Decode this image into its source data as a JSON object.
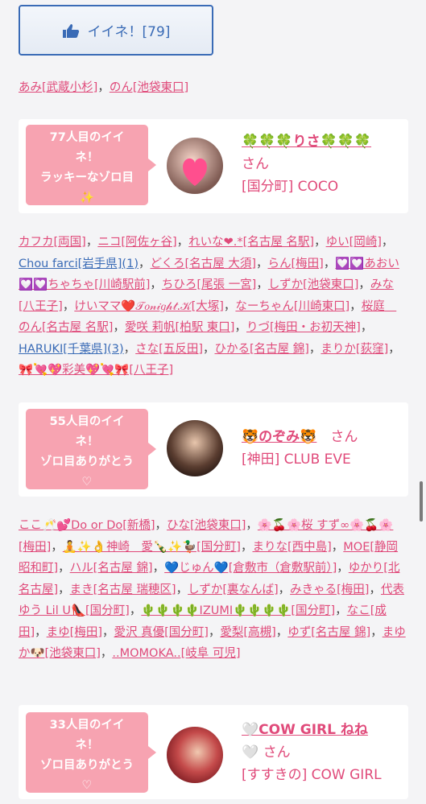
{
  "like_button": {
    "label": "イイネ！[79]"
  },
  "top_names": [
    {
      "text": "あみ[武蔵小杉]",
      "sep": "，"
    },
    {
      "text": "のん[池袋東口]",
      "sep": ""
    }
  ],
  "cards": [
    {
      "bubble": [
        "77人目のイイ",
        "ネ！",
        "ラッキーなゾロ目",
        "✨"
      ],
      "name": "🍀🍀🍀りさ🍀🍀🍀",
      "san": "さん",
      "shop": "[国分町] COCO"
    },
    {
      "bubble": [
        "55人目のイイ",
        "ネ！",
        "ゾロ目ありがとう",
        "♡"
      ],
      "name": "🐯のぞみ🐯",
      "san": "さん",
      "shop": "[神田] CLUB EVE"
    },
    {
      "bubble": [
        "33人目のイイ",
        "ネ！",
        "ゾロ目ありがとう",
        "♡"
      ],
      "name": "🤍COW GIRL ねね",
      "san": "🤍 さん",
      "shop": "[すすきの] COW GIRL"
    }
  ],
  "names_block_1": [
    {
      "text": "カフカ[両国]",
      "sep": "，"
    },
    {
      "text": "ニコ[阿佐ヶ谷]",
      "sep": "，"
    },
    {
      "text": "れいな❤︎.*[名古屋 名駅]",
      "sep": "，"
    },
    {
      "text": "ゆい[岡崎]",
      "sep": "，"
    },
    {
      "text": "Chou farci[岩手県](1)",
      "sep": "，",
      "blue": true
    },
    {
      "text": "どくろ[名古屋 大須]",
      "sep": "，"
    },
    {
      "text": "らん[梅田]",
      "sep": "，"
    },
    {
      "text": "💟💟あおい💟💟ちゃちゃ[川崎駅前]",
      "sep": "，"
    },
    {
      "text": "ちひろ[尾張 一宮]",
      "sep": "，"
    },
    {
      "text": "しずか[池袋東口]",
      "sep": "，"
    },
    {
      "text": "みな[八王子]",
      "sep": "，"
    },
    {
      "text": "けいママ❤️𝒯𝑜𝓃𝒾𝑔𝒽𝓉.𝒦[大塚]",
      "sep": "，"
    },
    {
      "text": "なーちゃん[川崎東口]",
      "sep": "，"
    },
    {
      "text": "桜庭　のん[名古屋 名駅]",
      "sep": "，"
    },
    {
      "text": "愛咲 莉帆[柏駅 東口]",
      "sep": "，"
    },
    {
      "text": "りづ[梅田・お初天神]",
      "sep": "，"
    },
    {
      "text": "HARUKI[千葉県](3)",
      "sep": "，",
      "blue": true
    },
    {
      "text": "さな[五反田]",
      "sep": "，"
    },
    {
      "text": "ひかる[名古屋 錦]",
      "sep": "，"
    },
    {
      "text": "まりか[荻窪]",
      "sep": "，"
    },
    {
      "text": "🎀💘💖彩美💖💘🎀[八王子]",
      "sep": ""
    }
  ],
  "names_block_2": [
    {
      "text": "ここ🥂💕Do or Do[新橋]",
      "sep": "，"
    },
    {
      "text": "ひな[池袋東口]",
      "sep": "，"
    },
    {
      "text": "🌸🍒🌸桜 すず∞🌸🍒🌸[梅田]",
      "sep": "，"
    },
    {
      "text": "🧘✨👌神崎　愛🍾✨🦆[国分町]",
      "sep": "，"
    },
    {
      "text": "まりな[西中島]",
      "sep": "，"
    },
    {
      "text": "MOE[静岡 昭和町]",
      "sep": "，"
    },
    {
      "text": "ハル[名古屋 錦]",
      "sep": "，"
    },
    {
      "text": "💙じゅん💙[倉敷市（倉敷駅前）]",
      "sep": "，"
    },
    {
      "text": "ゆかり[北名古屋]",
      "sep": "，"
    },
    {
      "text": "まき[名古屋 瑞穂区]",
      "sep": "，"
    },
    {
      "text": "しずか[裏なんば]",
      "sep": "，"
    },
    {
      "text": "みきゃる[梅田]",
      "sep": "，"
    },
    {
      "text": "代表 ゆう Lil U👠[国分町]",
      "sep": "，"
    },
    {
      "text": "🌵🌵🌵🌵IZUMI🌵🌵🌵🌵[国分町]",
      "sep": "，"
    },
    {
      "text": "なこ[成田]",
      "sep": "，"
    },
    {
      "text": "まゆ[梅田]",
      "sep": "，"
    },
    {
      "text": "愛沢 真優[国分町]",
      "sep": "，"
    },
    {
      "text": "愛梨[高槻]",
      "sep": "，"
    },
    {
      "text": "ゆず[名古屋 錦]",
      "sep": "，"
    },
    {
      "text": "まゆか🐶[池袋東口]",
      "sep": "，"
    },
    {
      "text": "..MOMOKA..[岐阜 可児]",
      "sep": ""
    }
  ],
  "colors": {
    "pink": "#e04a7a",
    "blue": "#3a6bb6",
    "bubble": "#f7a3b1"
  }
}
